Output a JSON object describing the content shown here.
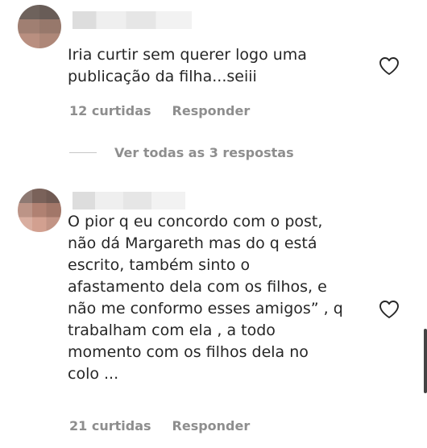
{
  "comments": [
    {
      "text": "Iria curtir sem querer logo uma\npublicação da filha...seiii",
      "likes": "12 curtidas",
      "reply_label": "Responder"
    },
    {
      "text": "O pior q eu concordo com o post,\nnão dá Margareth mas do q está\nescrito, também sinto o\nafastamento dela com os filhos, e\nnão me conformo esses amigos” , q\ntrabalham com ela , a todo\nmomento com os filhos dela no\ncolo ...",
      "likes": "21 curtidas",
      "reply_label": "Responder"
    }
  ],
  "replies_toggle": {
    "label": "Ver todas as 3 respostas"
  },
  "icons": {
    "like": "heart-outline-icon"
  },
  "colors": {
    "text": "#262626",
    "secondary": "#8e8e8e",
    "background": "#ffffff"
  }
}
